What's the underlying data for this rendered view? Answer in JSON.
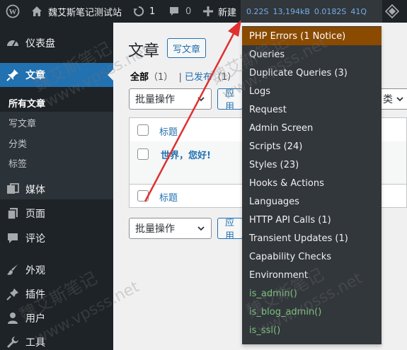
{
  "adminbar": {
    "site_name": "魏艾斯笔记测试站",
    "updates_count": "1",
    "comments_count": "0",
    "new_label": "新建",
    "qm_stats": [
      "0.22S",
      "13,194kB",
      "0.0182S",
      "41Q"
    ]
  },
  "sidebar": {
    "items": [
      {
        "label": "仪表盘",
        "icon": "dashboard-icon"
      },
      {
        "label": "文章",
        "icon": "pin-icon"
      },
      {
        "label": "媒体",
        "icon": "media-icon"
      },
      {
        "label": "页面",
        "icon": "pages-icon"
      },
      {
        "label": "评论",
        "icon": "comments-icon"
      },
      {
        "label": "外观",
        "icon": "appearance-icon"
      },
      {
        "label": "插件",
        "icon": "plugins-icon"
      },
      {
        "label": "用户",
        "icon": "users-icon"
      },
      {
        "label": "工具",
        "icon": "tools-icon"
      }
    ],
    "submenu": [
      "所有文章",
      "写文章",
      "分类",
      "标签"
    ]
  },
  "content": {
    "title": "文章",
    "add_new": "写文章",
    "filters": {
      "all": "全部",
      "all_count": "（1）",
      "sep": "|",
      "published": "已发布",
      "published_count": "（1）"
    },
    "bulk_label": "批量操作",
    "apply_label": "应用",
    "category_label": "类",
    "column_title": "标题",
    "post_title": "世界，您好!"
  },
  "qm_menu": {
    "items": [
      "PHP Errors (1 Notice)",
      "Queries",
      "Duplicate Queries (3)",
      "Logs",
      "Request",
      "Admin Screen",
      "Scripts (24)",
      "Styles (23)",
      "Hooks & Actions",
      "Languages",
      "HTTP API Calls (1)",
      "Transient Updates (1)",
      "Capability Checks",
      "Environment",
      "is_admin()",
      "is_blog_admin()",
      "is_ssl()"
    ]
  },
  "watermark": {
    "brand": "魏艾斯笔记",
    "url": "www.vpsss.net"
  },
  "colors": {
    "adminbar": "#1d2327",
    "accent": "#2271b1",
    "qm_menu": "#32373c",
    "qm_warning": "#8a4a00",
    "qm_condition": "#7dc17d",
    "arrow": "#e03030"
  }
}
